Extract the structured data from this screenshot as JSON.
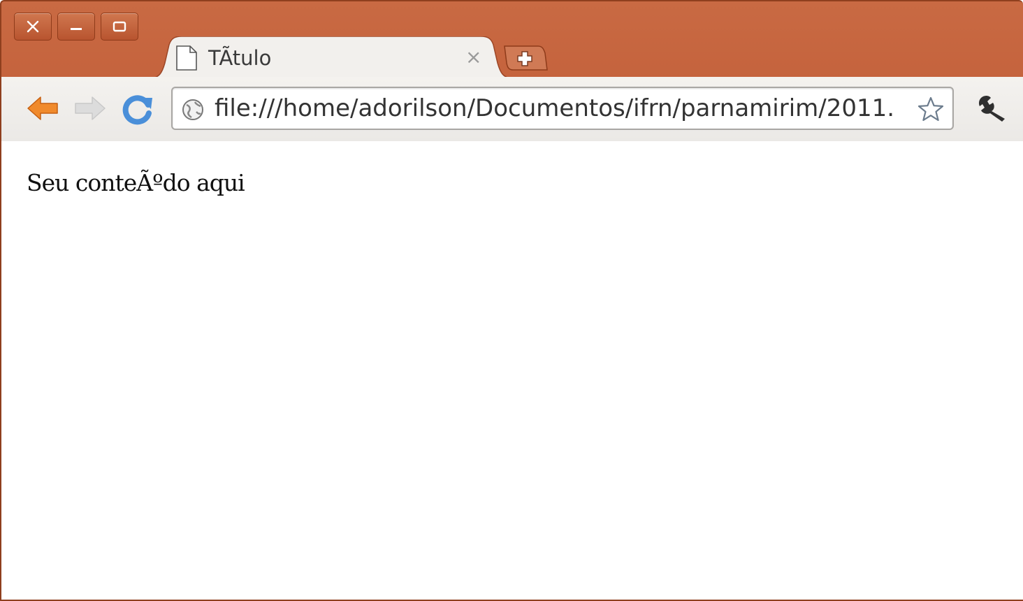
{
  "window": {
    "controls": [
      {
        "name": "close",
        "icon": "close-icon"
      },
      {
        "name": "minimize",
        "icon": "minimize-icon"
      },
      {
        "name": "maximize",
        "icon": "maximize-icon"
      }
    ],
    "frame_color": "#bd5733"
  },
  "tabs": [
    {
      "title": "TÃtulo",
      "favicon": "page-icon",
      "close_glyph": "×"
    }
  ],
  "new_tab": {
    "icon": "new-tab-icon"
  },
  "toolbar": {
    "back_icon": "back-arrow-icon",
    "forward_icon": "forward-arrow-icon",
    "reload_icon": "reload-icon",
    "address": {
      "icon": "globe-icon",
      "value": "file:///home/adorilson/Documentos/ifrn/parnamirim/2011."
    },
    "bookmark_icon": "star-icon",
    "menu_icon": "wrench-icon"
  },
  "page": {
    "text": "Seu conteÃºdo aqui"
  }
}
